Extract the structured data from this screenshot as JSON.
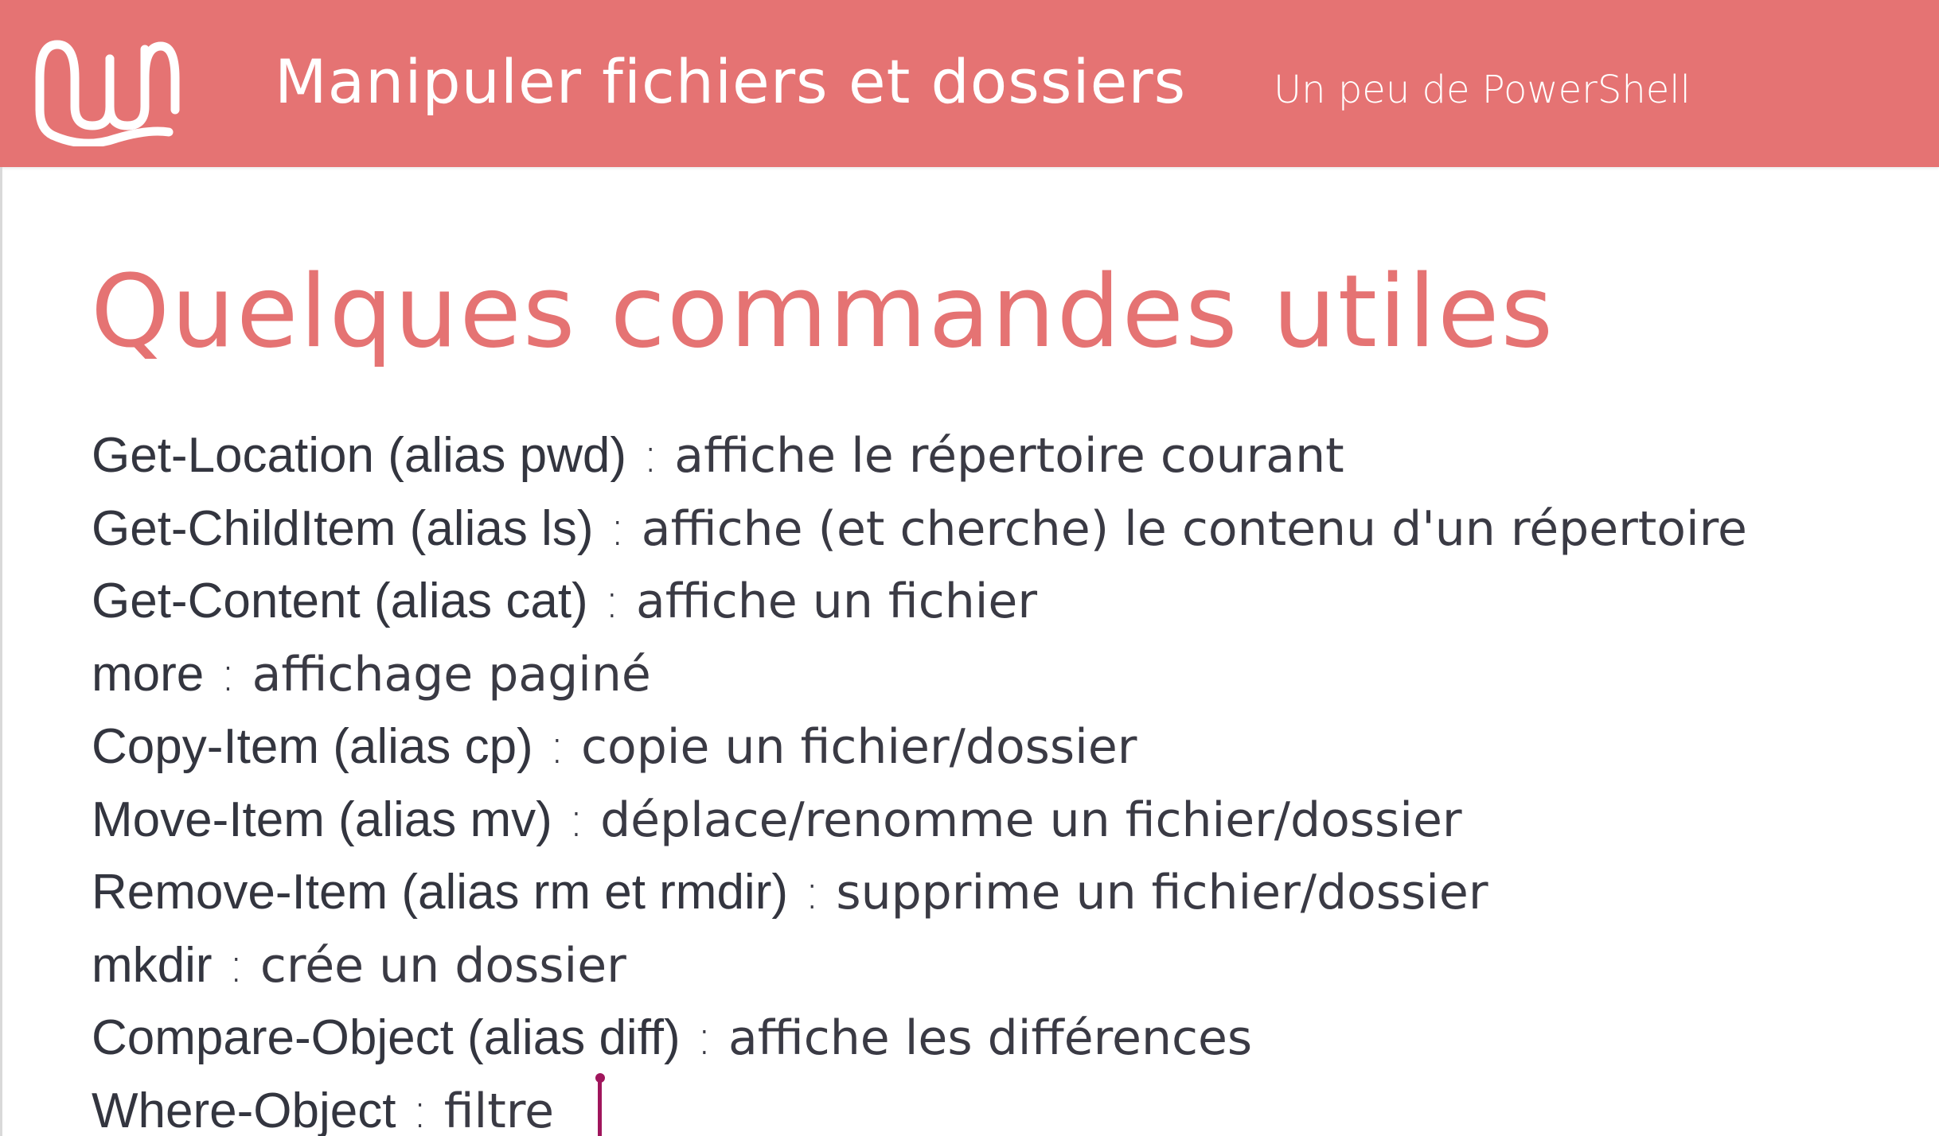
{
  "header": {
    "title": "Manipuler fichiers et dossiers",
    "subtitle": "Un peu de PowerShell",
    "logo": "wavy-logo-icon",
    "background_color": "#e57373"
  },
  "slide": {
    "title": "Quelques commandes utiles",
    "title_color": "#e57373",
    "commands": [
      {
        "name": "Get-Location (alias pwd)",
        "separator": " : ",
        "description": "affiche le répertoire courant"
      },
      {
        "name": "Get-ChildItem (alias ls)",
        "separator": " : ",
        "description": "affiche (et cherche) le contenu d'un répertoire"
      },
      {
        "name": "Get-Content (alias cat)",
        "separator": " : ",
        "description": "affiche un fichier"
      },
      {
        "name": "more",
        "separator": " : ",
        "description": "affichage paginé"
      },
      {
        "name": "Copy-Item (alias cp)",
        "separator": " : ",
        "description": "copie un fichier/dossier"
      },
      {
        "name": "Move-Item (alias mv)",
        "separator": " : ",
        "description": "déplace/renomme un fichier/dossier"
      },
      {
        "name": "Remove-Item (alias rm et rmdir)",
        "separator": " : ",
        "description": "supprime un fichier/dossier"
      },
      {
        "name": "mkdir",
        "separator": " : ",
        "description": "crée un dossier"
      },
      {
        "name": "Compare-Object (alias diff)",
        "separator": " : ",
        "description": "affiche les différences"
      },
      {
        "name": "Where-Object",
        "separator": " : ",
        "description": "filtre"
      }
    ]
  },
  "cursor": {
    "icon": "text-cursor-icon",
    "color": "#a0155c"
  }
}
